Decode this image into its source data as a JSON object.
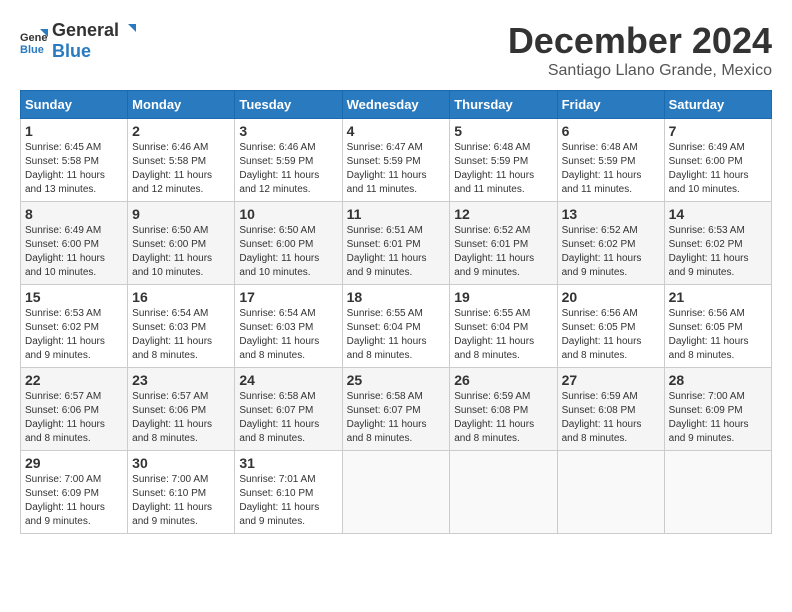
{
  "logo": {
    "general": "General",
    "blue": "Blue"
  },
  "title": "December 2024",
  "subtitle": "Santiago Llano Grande, Mexico",
  "days_header": [
    "Sunday",
    "Monday",
    "Tuesday",
    "Wednesday",
    "Thursday",
    "Friday",
    "Saturday"
  ],
  "weeks": [
    [
      {
        "day": "1",
        "rise": "6:45 AM",
        "set": "5:58 PM",
        "daylight": "11 hours and 13 minutes."
      },
      {
        "day": "2",
        "rise": "6:46 AM",
        "set": "5:58 PM",
        "daylight": "11 hours and 12 minutes."
      },
      {
        "day": "3",
        "rise": "6:46 AM",
        "set": "5:59 PM",
        "daylight": "11 hours and 12 minutes."
      },
      {
        "day": "4",
        "rise": "6:47 AM",
        "set": "5:59 PM",
        "daylight": "11 hours and 11 minutes."
      },
      {
        "day": "5",
        "rise": "6:48 AM",
        "set": "5:59 PM",
        "daylight": "11 hours and 11 minutes."
      },
      {
        "day": "6",
        "rise": "6:48 AM",
        "set": "5:59 PM",
        "daylight": "11 hours and 11 minutes."
      },
      {
        "day": "7",
        "rise": "6:49 AM",
        "set": "6:00 PM",
        "daylight": "11 hours and 10 minutes."
      }
    ],
    [
      {
        "day": "8",
        "rise": "6:49 AM",
        "set": "6:00 PM",
        "daylight": "11 hours and 10 minutes."
      },
      {
        "day": "9",
        "rise": "6:50 AM",
        "set": "6:00 PM",
        "daylight": "11 hours and 10 minutes."
      },
      {
        "day": "10",
        "rise": "6:50 AM",
        "set": "6:00 PM",
        "daylight": "11 hours and 10 minutes."
      },
      {
        "day": "11",
        "rise": "6:51 AM",
        "set": "6:01 PM",
        "daylight": "11 hours and 9 minutes."
      },
      {
        "day": "12",
        "rise": "6:52 AM",
        "set": "6:01 PM",
        "daylight": "11 hours and 9 minutes."
      },
      {
        "day": "13",
        "rise": "6:52 AM",
        "set": "6:02 PM",
        "daylight": "11 hours and 9 minutes."
      },
      {
        "day": "14",
        "rise": "6:53 AM",
        "set": "6:02 PM",
        "daylight": "11 hours and 9 minutes."
      }
    ],
    [
      {
        "day": "15",
        "rise": "6:53 AM",
        "set": "6:02 PM",
        "daylight": "11 hours and 9 minutes."
      },
      {
        "day": "16",
        "rise": "6:54 AM",
        "set": "6:03 PM",
        "daylight": "11 hours and 8 minutes."
      },
      {
        "day": "17",
        "rise": "6:54 AM",
        "set": "6:03 PM",
        "daylight": "11 hours and 8 minutes."
      },
      {
        "day": "18",
        "rise": "6:55 AM",
        "set": "6:04 PM",
        "daylight": "11 hours and 8 minutes."
      },
      {
        "day": "19",
        "rise": "6:55 AM",
        "set": "6:04 PM",
        "daylight": "11 hours and 8 minutes."
      },
      {
        "day": "20",
        "rise": "6:56 AM",
        "set": "6:05 PM",
        "daylight": "11 hours and 8 minutes."
      },
      {
        "day": "21",
        "rise": "6:56 AM",
        "set": "6:05 PM",
        "daylight": "11 hours and 8 minutes."
      }
    ],
    [
      {
        "day": "22",
        "rise": "6:57 AM",
        "set": "6:06 PM",
        "daylight": "11 hours and 8 minutes."
      },
      {
        "day": "23",
        "rise": "6:57 AM",
        "set": "6:06 PM",
        "daylight": "11 hours and 8 minutes."
      },
      {
        "day": "24",
        "rise": "6:58 AM",
        "set": "6:07 PM",
        "daylight": "11 hours and 8 minutes."
      },
      {
        "day": "25",
        "rise": "6:58 AM",
        "set": "6:07 PM",
        "daylight": "11 hours and 8 minutes."
      },
      {
        "day": "26",
        "rise": "6:59 AM",
        "set": "6:08 PM",
        "daylight": "11 hours and 8 minutes."
      },
      {
        "day": "27",
        "rise": "6:59 AM",
        "set": "6:08 PM",
        "daylight": "11 hours and 8 minutes."
      },
      {
        "day": "28",
        "rise": "7:00 AM",
        "set": "6:09 PM",
        "daylight": "11 hours and 9 minutes."
      }
    ],
    [
      {
        "day": "29",
        "rise": "7:00 AM",
        "set": "6:09 PM",
        "daylight": "11 hours and 9 minutes."
      },
      {
        "day": "30",
        "rise": "7:00 AM",
        "set": "6:10 PM",
        "daylight": "11 hours and 9 minutes."
      },
      {
        "day": "31",
        "rise": "7:01 AM",
        "set": "6:10 PM",
        "daylight": "11 hours and 9 minutes."
      },
      null,
      null,
      null,
      null
    ]
  ]
}
